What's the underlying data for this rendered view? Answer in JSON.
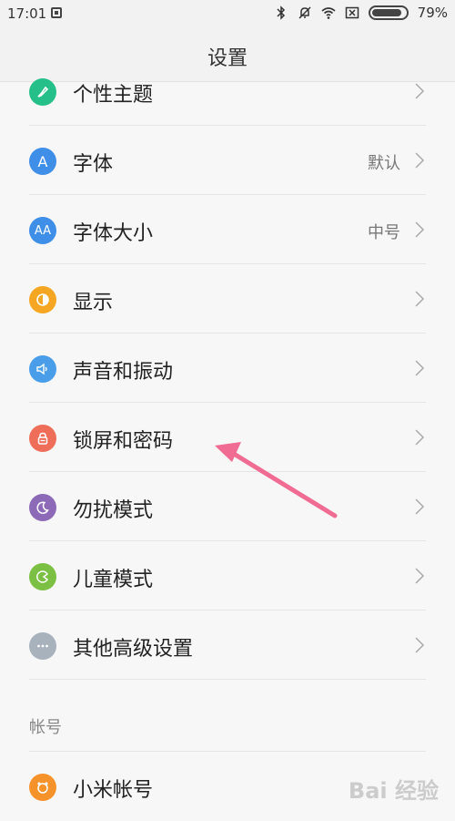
{
  "status_bar": {
    "time": "17:01",
    "battery": "79%"
  },
  "header": {
    "title": "设置"
  },
  "items": [
    {
      "label": "个性主题",
      "value": "",
      "icon": "theme-icon",
      "color": "#25c08a"
    },
    {
      "label": "字体",
      "value": "默认",
      "icon": "font-icon",
      "color": "#3f8fe8"
    },
    {
      "label": "字体大小",
      "value": "中号",
      "icon": "font-size-icon",
      "color": "#3f8fe8"
    },
    {
      "label": "显示",
      "value": "",
      "icon": "display-icon",
      "color": "#f5a623"
    },
    {
      "label": "声音和振动",
      "value": "",
      "icon": "sound-icon",
      "color": "#4a9de8"
    },
    {
      "label": "锁屏和密码",
      "value": "",
      "icon": "lock-icon",
      "color": "#ee6e5a"
    },
    {
      "label": "勿扰模式",
      "value": "",
      "icon": "moon-icon",
      "color": "#8c6ab8"
    },
    {
      "label": "儿童模式",
      "value": "",
      "icon": "child-icon",
      "color": "#7cc043"
    },
    {
      "label": "其他高级设置",
      "value": "",
      "icon": "more-icon",
      "color": "#a7b2bd"
    }
  ],
  "section": {
    "title": "帐号"
  },
  "account": {
    "label": "小米帐号",
    "icon": "mi-account-icon",
    "color": "#f5922a"
  },
  "watermark": "Bai 经验"
}
